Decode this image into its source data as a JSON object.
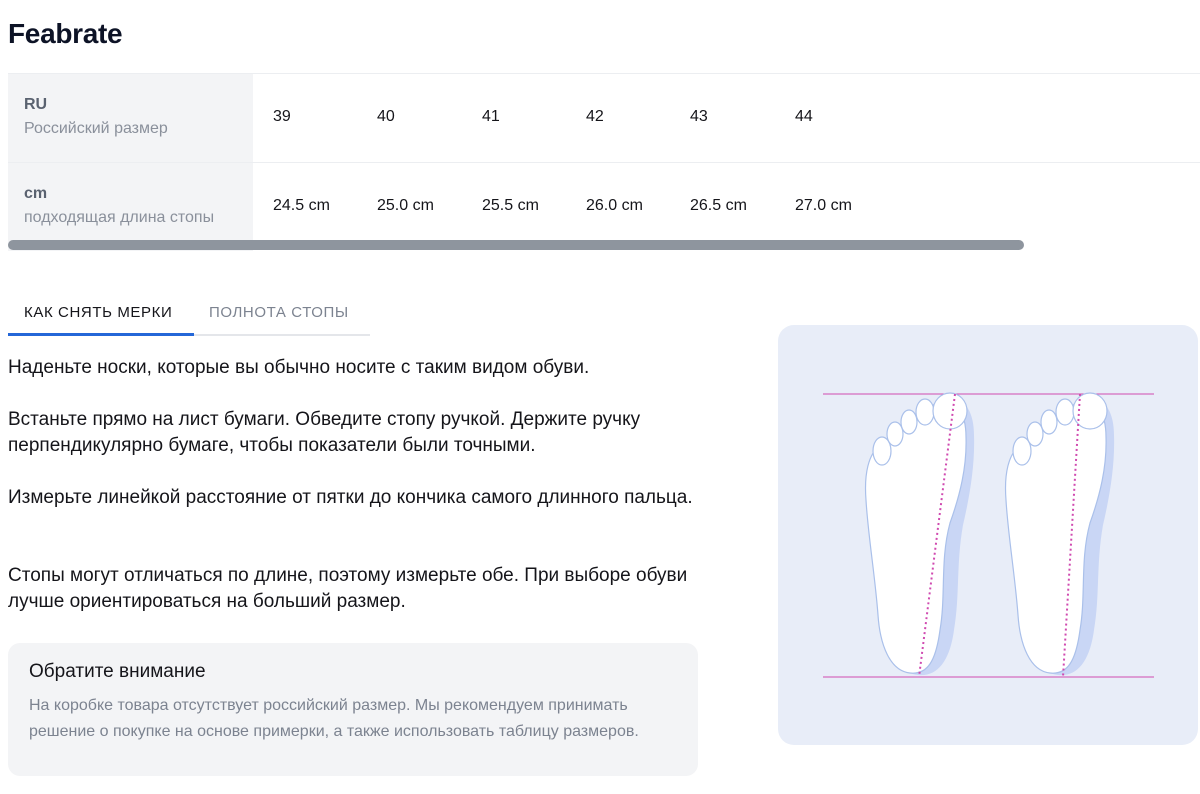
{
  "brand": "Feabrate",
  "size_table": {
    "rows": [
      {
        "code": "RU",
        "desc": "Российский размер",
        "values": [
          "39",
          "40",
          "41",
          "42",
          "43",
          "44"
        ]
      },
      {
        "code": "cm",
        "desc": "подходящая длина стопы",
        "values": [
          "24.5 cm",
          "25.0 cm",
          "25.5 cm",
          "26.0 cm",
          "26.5 cm",
          "27.0 cm"
        ]
      }
    ]
  },
  "tabs": {
    "measure": "КАК СНЯТЬ МЕРКИ",
    "width": "ПОЛНОТА СТОПЫ",
    "active": "measure"
  },
  "instructions": [
    "Наденьте носки, которые вы обычно носите с таким видом обуви.",
    "Встаньте прямо на лист бумаги. Обведите стопу ручкой. Держите ручку перпендикулярно бумаге, чтобы показатели были точными.",
    "Измерьте линейкой расстояние от пятки до кончика самого длинного пальца.",
    "Стопы могут отличаться по длине, поэтому измерьте обе. При выборе обуви лучше ориентироваться на больший размер."
  ],
  "notice": {
    "title": "Обратите внимание",
    "text": "На коробке товара отсутствует российский размер. Мы рекомендуем принимать решение о покупке на основе примерки, а также использовать таблицу размеров."
  },
  "colors": {
    "accent": "#2467d8",
    "guide_line": "#d04ab0",
    "foot_fill": "#ffffff",
    "foot_shadow": "#c9d6f5",
    "panel_bg": "#e8edf8"
  },
  "icons": [
    "foot-outline-icon",
    "foot-outline-icon"
  ]
}
